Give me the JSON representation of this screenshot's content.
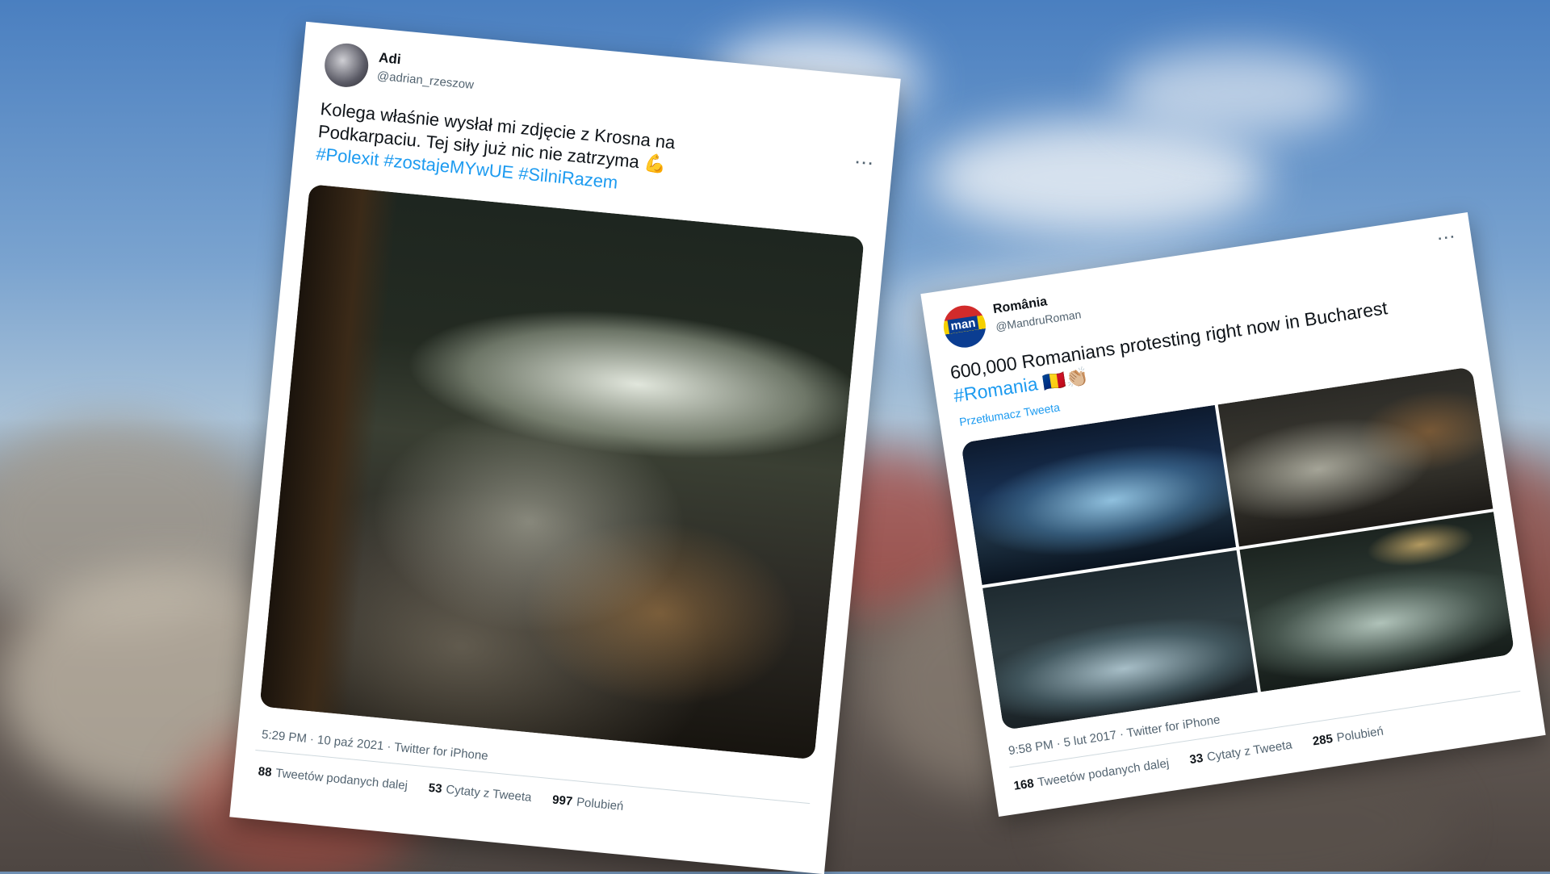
{
  "tweet1": {
    "display_name": "Adi",
    "handle": "@adrian_rzeszow",
    "more_icon": "more-horizontal-icon",
    "text_line1": "Kolega właśnie wysłał mi zdjęcie z Krosna na",
    "text_line2": "Podkarpaciu. Tej siły już nic nie zatrzyma",
    "emoji": "💪",
    "hashtags": [
      "#Polexit",
      "#zostajeMYwUE",
      "#SilniRazem"
    ],
    "timestamp": "5:29 PM · 10 paź 2021 · Twitter for iPhone",
    "stats": {
      "retweets_count": "88",
      "retweets_label": "Tweetów podanych dalej",
      "quotes_count": "53",
      "quotes_label": "Cytaty z Tweeta",
      "likes_count": "997",
      "likes_label": "Polubień"
    }
  },
  "tweet2": {
    "display_name": "România",
    "handle": "@MandruRoman",
    "avatar_text": "man",
    "more_icon": "more-horizontal-icon",
    "text_line1": "600,000 Romanians protesting right now in Bucharest",
    "hashtag": "#Romania",
    "emojis": "🇷🇴👏🏼",
    "translate_label": "Przetłumacz Tweeta",
    "timestamp": "9:58 PM · 5 lut 2017 · Twitter for iPhone",
    "stats": {
      "retweets_count": "168",
      "retweets_label": "Tweetów podanych dalej",
      "quotes_count": "33",
      "quotes_label": "Cytaty z Tweeta",
      "likes_count": "285",
      "likes_label": "Polubień"
    }
  },
  "colors": {
    "link": "#1d9bf0",
    "text": "#0f1419",
    "secondary": "#536471"
  }
}
